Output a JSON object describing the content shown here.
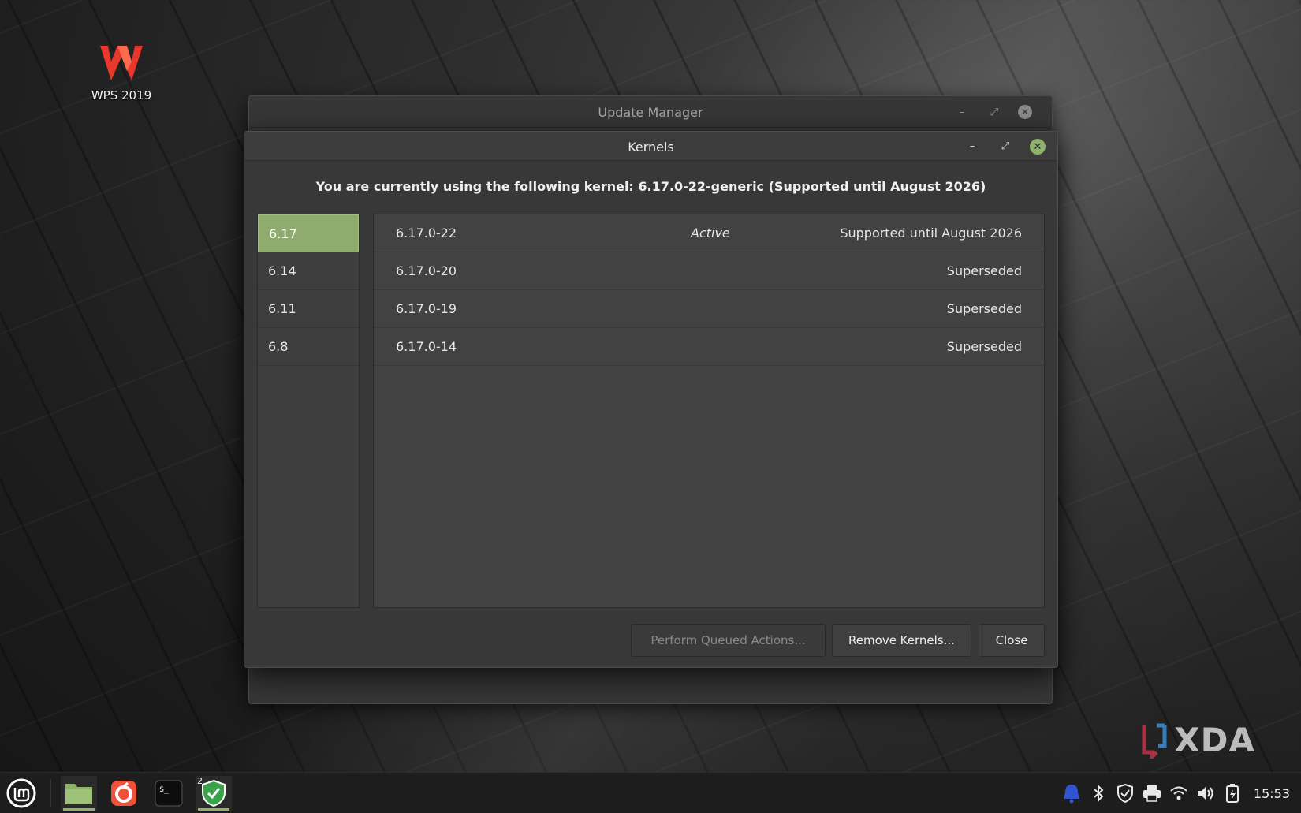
{
  "desktop": {
    "icon_label": "WPS 2019"
  },
  "back_window": {
    "title": "Update Manager"
  },
  "kernels_window": {
    "title": "Kernels",
    "current_kernel_text": "You are currently using the following kernel: 6.17.0-22-generic (Supported until August 2026)",
    "series": [
      {
        "label": "6.17",
        "selected": true
      },
      {
        "label": "6.14",
        "selected": false
      },
      {
        "label": "6.11",
        "selected": false
      },
      {
        "label": "6.8",
        "selected": false
      }
    ],
    "kernels": [
      {
        "version": "6.17.0-22",
        "status": "Active",
        "support": "Supported until August 2026"
      },
      {
        "version": "6.17.0-20",
        "status": "",
        "support": "Superseded"
      },
      {
        "version": "6.17.0-19",
        "status": "",
        "support": "Superseded"
      },
      {
        "version": "6.17.0-14",
        "status": "",
        "support": "Superseded"
      }
    ],
    "buttons": {
      "queued": "Perform Queued Actions...",
      "remove": "Remove Kernels...",
      "close": "Close"
    }
  },
  "watermark": {
    "text": "XDA"
  },
  "taskbar": {
    "apps": [
      {
        "icon": "folder-icon",
        "active": true
      },
      {
        "icon": "firefox-icon",
        "active": false
      },
      {
        "icon": "terminal-icon",
        "active": false
      },
      {
        "icon": "update-manager-shield-icon",
        "active": true,
        "badge": "2"
      }
    ],
    "tray_icons": [
      "notification-bell-icon",
      "bluetooth-icon",
      "shield-icon",
      "printer-icon",
      "wifi-icon",
      "volume-icon",
      "battery-icon"
    ],
    "clock": "15:53"
  },
  "colors": {
    "accent_green": "#8fab6e",
    "close_green": "#8fb26a",
    "wps_red": "#e8382d"
  }
}
